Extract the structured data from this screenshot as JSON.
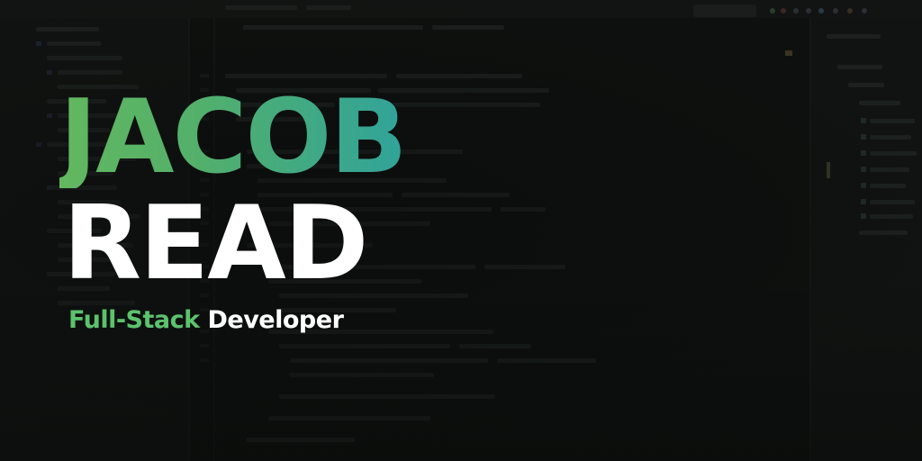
{
  "banner": {
    "first_name": "JACOB",
    "last_name": "READ",
    "tagline_accent": "Full-Stack",
    "tagline_rest": "Developer"
  },
  "colors": {
    "gradient_start": "#62b85f",
    "gradient_end": "#30a39a",
    "accent_green": "#5cc26d",
    "text_white": "#ffffff",
    "background": "#0e100f"
  },
  "icons": [
    "code-editor-background"
  ]
}
